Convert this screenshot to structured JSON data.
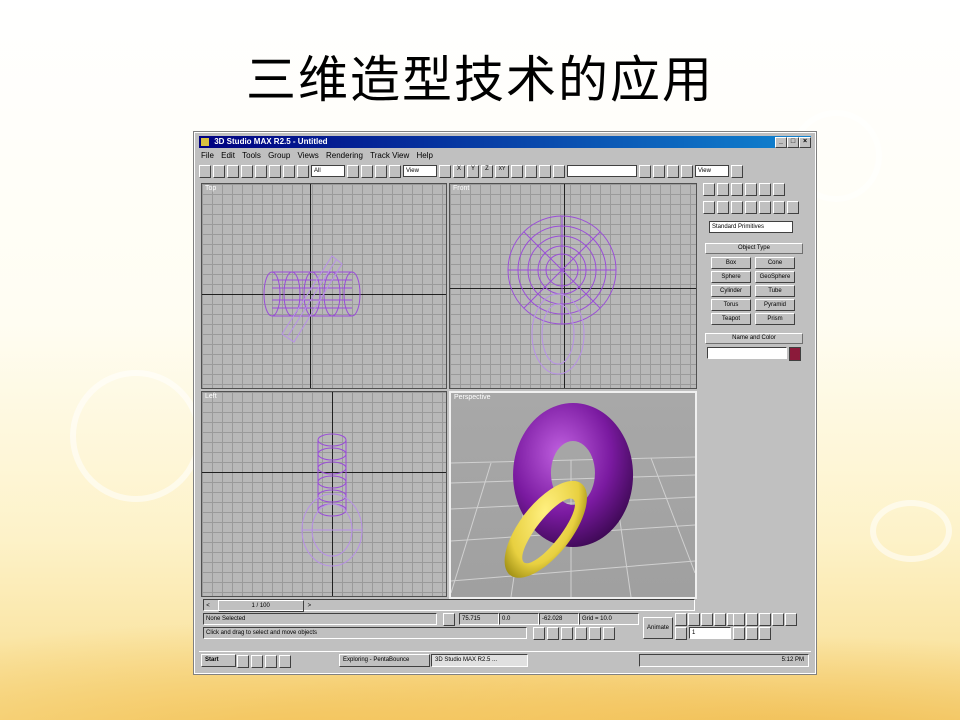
{
  "slide": {
    "title": "三维造型技术的应用"
  },
  "window": {
    "title": "3D Studio MAX R2.5 - Untitled",
    "menu": [
      "File",
      "Edit",
      "Tools",
      "Group",
      "Views",
      "Rendering",
      "Track View",
      "Help"
    ],
    "toolbar": {
      "selection_filter": "All",
      "ref_coord": "View",
      "axis_x": "X",
      "axis_y": "Y",
      "axis_z": "Z",
      "axis_xy": "XY",
      "right_combo": "View"
    }
  },
  "viewports": {
    "top": "Top",
    "front": "Front",
    "left": "Left",
    "perspective": "Perspective"
  },
  "command_panel": {
    "category_dropdown": "Standard Primitives",
    "object_type_header": "Object Type",
    "buttons": [
      "Box",
      "Cone",
      "Sphere",
      "GeoSphere",
      "Cylinder",
      "Tube",
      "Torus",
      "Pyramid",
      "Teapot",
      "Prism"
    ],
    "name_color_header": "Name and Color",
    "color_swatch": "#8b1a3a"
  },
  "timeline": {
    "frame": "1 / 100"
  },
  "status": {
    "selection": "None Selected",
    "prompt": "Click and drag to select and move objects",
    "x": "75.715",
    "y": "0.0",
    "z": "-62.028",
    "grid": "Grid = 10.0",
    "animate": "Animate",
    "frame_field": "1"
  },
  "taskbar": {
    "start": "Start",
    "task1": "Exploring - PentaBounce",
    "task2": "3D Studio MAX R2.5 ...",
    "clock": "5:12 PM"
  },
  "colors": {
    "wire_purple": "#9a4dd8",
    "torus_purple": "#7a1aa0",
    "ring_yellow": "#e8d040",
    "title_bar": "#000080"
  }
}
